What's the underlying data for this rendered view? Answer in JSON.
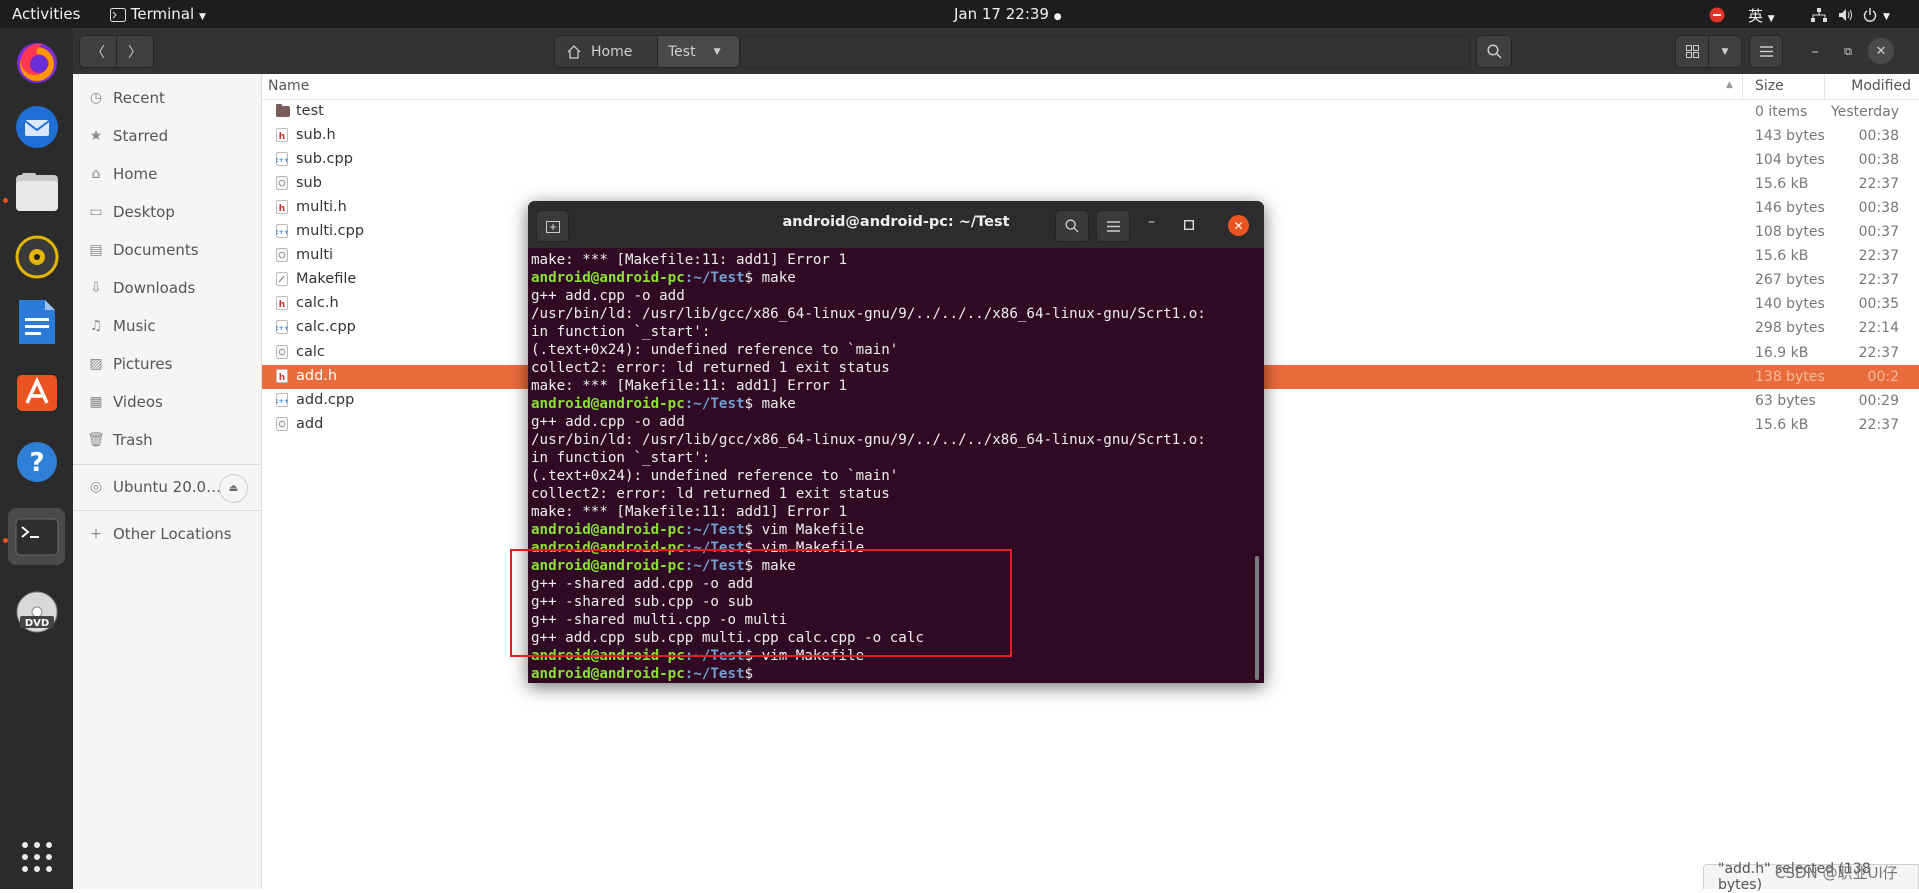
{
  "topbar": {
    "activities": "Activities",
    "app_name": "Terminal",
    "datetime": "Jan 17  22:39",
    "input_method": "英"
  },
  "dock": {
    "items": [
      "firefox-icon",
      "thunderbird-icon",
      "files-icon",
      "rhythmbox-icon",
      "libreoffice-writer-icon",
      "ubuntu-software-icon",
      "help-icon",
      "terminal-icon",
      "dvd-icon",
      "show-applications-icon"
    ]
  },
  "nautilus": {
    "breadcrumb": {
      "home": "Home",
      "current": "Test"
    },
    "sidebar": {
      "items": [
        {
          "label": "Recent",
          "icon": "clock-icon"
        },
        {
          "label": "Starred",
          "icon": "star-icon"
        },
        {
          "label": "Home",
          "icon": "home-icon"
        },
        {
          "label": "Desktop",
          "icon": "desktop-icon"
        },
        {
          "label": "Documents",
          "icon": "documents-icon"
        },
        {
          "label": "Downloads",
          "icon": "downloads-icon"
        },
        {
          "label": "Music",
          "icon": "music-icon"
        },
        {
          "label": "Pictures",
          "icon": "pictures-icon"
        },
        {
          "label": "Videos",
          "icon": "videos-icon"
        },
        {
          "label": "Trash",
          "icon": "trash-icon"
        }
      ],
      "volume": "Ubuntu 20.0…",
      "other_locations": "Other Locations"
    },
    "columns": {
      "name": "Name",
      "size": "Size",
      "modified": "Modified"
    },
    "files": [
      {
        "name": "test",
        "type": "folder",
        "size": "0 items",
        "modified": "Yesterday"
      },
      {
        "name": "sub.h",
        "type": "header",
        "size": "143 bytes",
        "modified": "00:38"
      },
      {
        "name": "sub.cpp",
        "type": "source",
        "size": "104 bytes",
        "modified": "00:38"
      },
      {
        "name": "sub",
        "type": "binary",
        "size": "15.6 kB",
        "modified": "22:37"
      },
      {
        "name": "multi.h",
        "type": "header",
        "size": "146 bytes",
        "modified": "00:38"
      },
      {
        "name": "multi.cpp",
        "type": "source",
        "size": "108 bytes",
        "modified": "00:37"
      },
      {
        "name": "multi",
        "type": "binary",
        "size": "15.6 kB",
        "modified": "22:37"
      },
      {
        "name": "Makefile",
        "type": "text",
        "size": "267 bytes",
        "modified": "22:37"
      },
      {
        "name": "calc.h",
        "type": "header",
        "size": "140 bytes",
        "modified": "00:35"
      },
      {
        "name": "calc.cpp",
        "type": "source",
        "size": "298 bytes",
        "modified": "22:14"
      },
      {
        "name": "calc",
        "type": "binary",
        "size": "16.9 kB",
        "modified": "22:37"
      },
      {
        "name": "add.h",
        "type": "header",
        "size": "138 bytes",
        "modified": "00:2",
        "selected": true
      },
      {
        "name": "add.cpp",
        "type": "source",
        "size": "63 bytes",
        "modified": "00:29"
      },
      {
        "name": "add",
        "type": "binary",
        "size": "15.6 kB",
        "modified": "22:37"
      }
    ],
    "status": "\"add.h\" selected (138 bytes)"
  },
  "terminal": {
    "title": "android@android-pc: ~/Test",
    "prompt_user": "android@android-pc",
    "prompt_path": ":~/Test",
    "lines": [
      {
        "kind": "out",
        "text": "make: *** [Makefile:11: add1] Error 1"
      },
      {
        "kind": "prompt",
        "cmd": "$ make"
      },
      {
        "kind": "out",
        "text": "g++ add.cpp -o add"
      },
      {
        "kind": "out",
        "text": "/usr/bin/ld: /usr/lib/gcc/x86_64-linux-gnu/9/../../../x86_64-linux-gnu/Scrt1.o:"
      },
      {
        "kind": "out",
        "text": "in function `_start':"
      },
      {
        "kind": "out",
        "text": "(.text+0x24): undefined reference to `main'"
      },
      {
        "kind": "out",
        "text": "collect2: error: ld returned 1 exit status"
      },
      {
        "kind": "out",
        "text": "make: *** [Makefile:11: add1] Error 1"
      },
      {
        "kind": "prompt",
        "cmd": "$ make"
      },
      {
        "kind": "out",
        "text": "g++ add.cpp -o add"
      },
      {
        "kind": "out",
        "text": "/usr/bin/ld: /usr/lib/gcc/x86_64-linux-gnu/9/../../../x86_64-linux-gnu/Scrt1.o:"
      },
      {
        "kind": "out",
        "text": "in function `_start':"
      },
      {
        "kind": "out",
        "text": "(.text+0x24): undefined reference to `main'"
      },
      {
        "kind": "out",
        "text": "collect2: error: ld returned 1 exit status"
      },
      {
        "kind": "out",
        "text": "make: *** [Makefile:11: add1] Error 1"
      },
      {
        "kind": "prompt",
        "cmd": "$ vim Makefile"
      },
      {
        "kind": "prompt",
        "cmd": "$ vim Makefile"
      },
      {
        "kind": "prompt",
        "cmd": "$ make"
      },
      {
        "kind": "out",
        "text": "g++ -shared add.cpp -o add"
      },
      {
        "kind": "out",
        "text": "g++ -shared sub.cpp -o sub"
      },
      {
        "kind": "out",
        "text": "g++ -shared multi.cpp -o multi"
      },
      {
        "kind": "out",
        "text": "g++ add.cpp sub.cpp multi.cpp calc.cpp -o calc"
      },
      {
        "kind": "prompt",
        "cmd": "$ vim Makefile"
      },
      {
        "kind": "prompt",
        "cmd": "$ "
      }
    ]
  },
  "watermark": "CSDN @职业Ul仔",
  "colors": {
    "accent": "#e95420",
    "selection": "#e96d3c",
    "terminal_bg": "#300a24",
    "prompt_user": "#8ae234",
    "prompt_path": "#729fcf",
    "highlight_box": "#e02020"
  }
}
